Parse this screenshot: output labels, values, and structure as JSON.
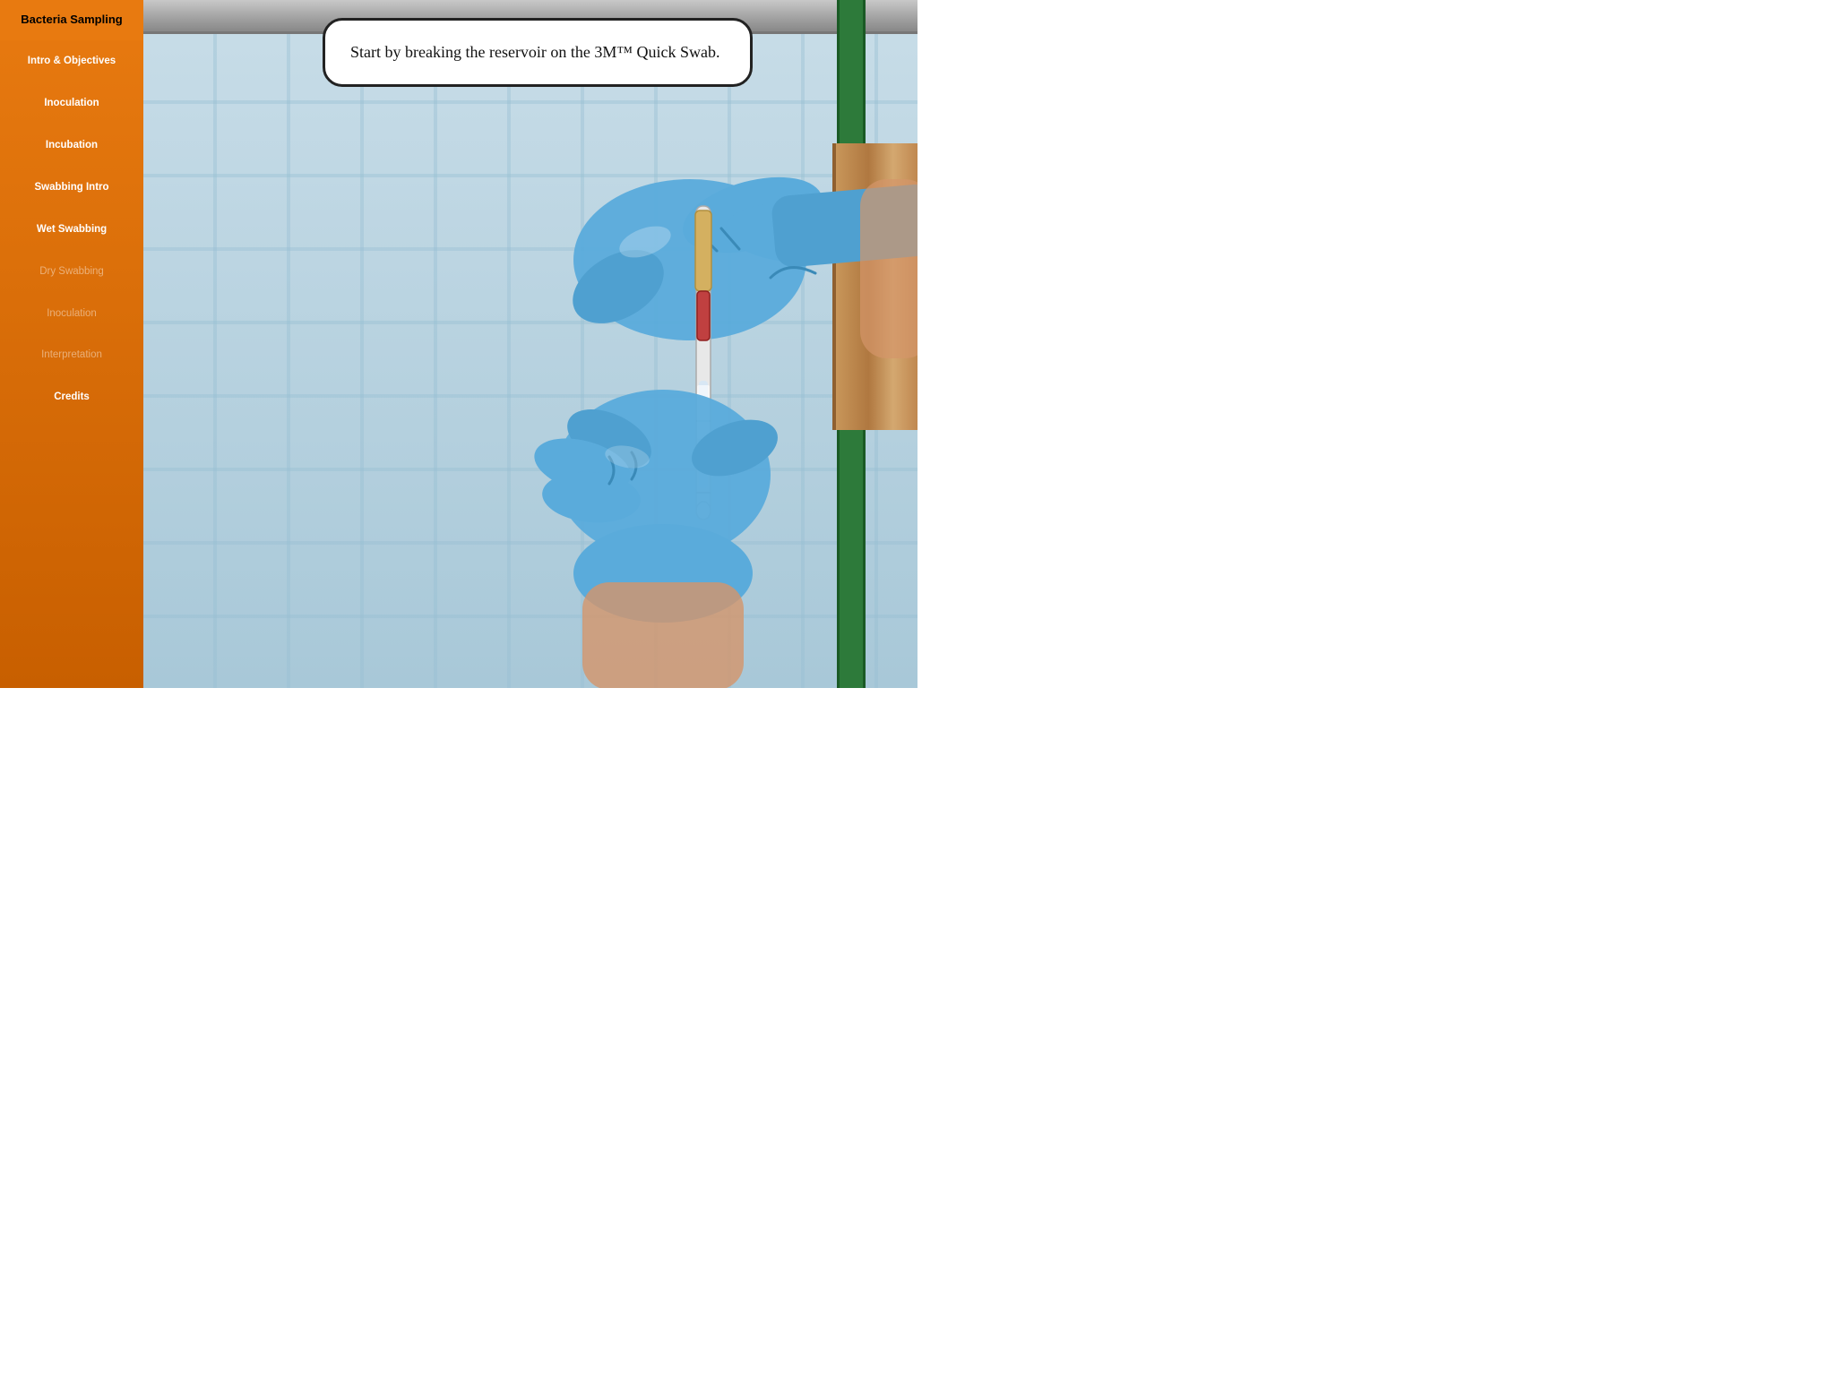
{
  "sidebar": {
    "title": "Bacteria Sampling",
    "items": [
      {
        "id": "intro",
        "label": "Intro & Objectives",
        "active": true,
        "dimmed": false
      },
      {
        "id": "inoculation1",
        "label": "Inoculation",
        "active": true,
        "dimmed": false
      },
      {
        "id": "incubation",
        "label": "Incubation",
        "active": true,
        "dimmed": false
      },
      {
        "id": "swabbing-intro",
        "label": "Swabbing Intro",
        "active": true,
        "dimmed": false
      },
      {
        "id": "wet-swabbing",
        "label": "Wet Swabbing",
        "active": true,
        "dimmed": false
      },
      {
        "id": "dry-swabbing",
        "label": "Dry Swabbing",
        "active": false,
        "dimmed": true
      },
      {
        "id": "inoculation2",
        "label": "Inoculation",
        "active": false,
        "dimmed": true
      },
      {
        "id": "interpretation",
        "label": "Interpretation",
        "active": false,
        "dimmed": true
      },
      {
        "id": "credits",
        "label": "Credits",
        "active": true,
        "dimmed": false
      }
    ]
  },
  "scene": {
    "speech_bubble_text": "Start by breaking the reservoir on the 3M™ Quick Swab."
  }
}
